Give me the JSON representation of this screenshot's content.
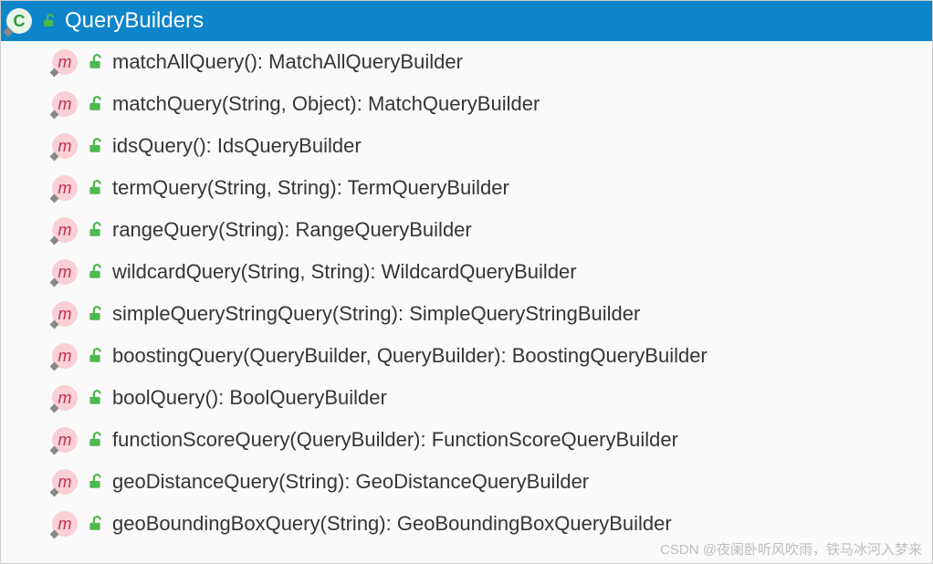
{
  "header": {
    "title": "QueryBuilders",
    "class_icon_letter": "C"
  },
  "methods": [
    {
      "signature": "matchAllQuery(): MatchAllQueryBuilder"
    },
    {
      "signature": "matchQuery(String, Object): MatchQueryBuilder"
    },
    {
      "signature": "idsQuery(): IdsQueryBuilder"
    },
    {
      "signature": "termQuery(String, String): TermQueryBuilder"
    },
    {
      "signature": "rangeQuery(String): RangeQueryBuilder"
    },
    {
      "signature": "wildcardQuery(String, String): WildcardQueryBuilder"
    },
    {
      "signature": "simpleQueryStringQuery(String): SimpleQueryStringBuilder"
    },
    {
      "signature": "boostingQuery(QueryBuilder, QueryBuilder): BoostingQueryBuilder"
    },
    {
      "signature": "boolQuery(): BoolQueryBuilder"
    },
    {
      "signature": "functionScoreQuery(QueryBuilder): FunctionScoreQueryBuilder"
    },
    {
      "signature": "geoDistanceQuery(String): GeoDistanceQueryBuilder"
    },
    {
      "signature": "geoBoundingBoxQuery(String): GeoBoundingBoxQueryBuilder"
    }
  ],
  "method_icon_letter": "m",
  "watermark": "CSDN @夜阑卧听风吹雨，铁马冰河入梦来"
}
